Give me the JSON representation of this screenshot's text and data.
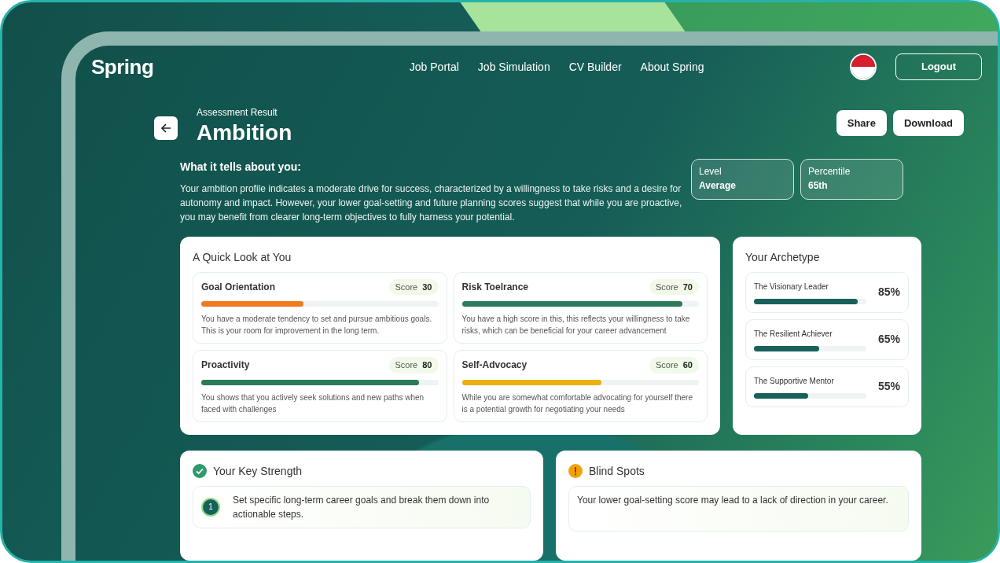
{
  "nav": {
    "logo": "Spring",
    "links": [
      "Job Portal",
      "Job Simulation",
      "CV Builder",
      "About Spring"
    ],
    "logout": "Logout"
  },
  "header": {
    "eyebrow": "Assessment Result",
    "title": "Ambition",
    "actions": [
      "Share",
      "Download"
    ]
  },
  "summary": {
    "heading": "What it tells about you:",
    "text": "Your ambition profile indicates a moderate drive for success, characterized by a willingness to take risks and a desire for autonomy and impact. However, your lower goal-setting and future planning scores suggest that while you are proactive, you may benefit from clearer long-term objectives to fully harness your potential.",
    "stats": [
      {
        "label": "Level",
        "value": "Average"
      },
      {
        "label": "Percentile",
        "value": "65th"
      }
    ]
  },
  "quick_look": {
    "title": "A Quick Look at You",
    "traits": [
      {
        "name": "Goal Orientation",
        "score_label": "Score",
        "score": "30",
        "level": 0.43,
        "color": "#f07a1c",
        "text": "You have a moderate tendency to set and pursue ambitious goals. This is  your room for improvement in the long term."
      },
      {
        "name": "Risk Toelrance",
        "score_label": "Score",
        "score": "70",
        "level": 0.93,
        "color": "#2b7a58",
        "text": "You have a high score in this, this reflects your willingness to take risks, which can be beneficial for your career advancement"
      },
      {
        "name": "Proactivity",
        "score_label": "Score",
        "score": "80",
        "level": 0.92,
        "color": "#2b7a58",
        "text": "You shows that you actively seek solutions and new paths when faced with challenges"
      },
      {
        "name": "Self-Advocacy",
        "score_label": "Score",
        "score": "60",
        "level": 0.59,
        "color": "#e9b00f",
        "text": "While you are somewhat comfortable advocating for yourself there is a potential growth for negotiating your needs"
      }
    ]
  },
  "archetype": {
    "title": "Your Archetype",
    "items": [
      {
        "name": "The Visionary Leader",
        "percent": "85%",
        "level": 0.92
      },
      {
        "name": "The Resilient Achiever",
        "percent": "65%",
        "level": 0.58
      },
      {
        "name": "The Supportive Mentor",
        "percent": "55%",
        "level": 0.48
      }
    ]
  },
  "strengths": {
    "title": "Your Key Strength",
    "items": [
      {
        "number": "1",
        "text": "Set specific long-term career goals and break them down into actionable steps."
      }
    ]
  },
  "blind_spots": {
    "title": "Blind Spots",
    "items": [
      "Your lower goal-setting score may lead to a lack of direction in your career."
    ]
  }
}
